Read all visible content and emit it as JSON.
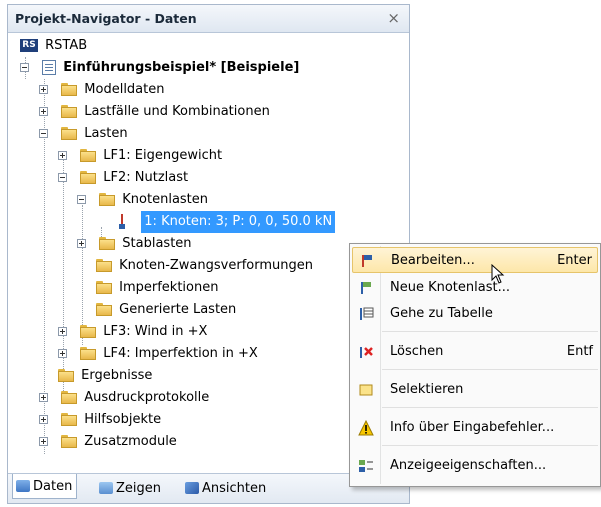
{
  "panel": {
    "title": "Projekt-Navigator - Daten",
    "close": "×"
  },
  "tree": {
    "root": "RSTAB",
    "project": "Einführungsbeispiel* [Beispiele]",
    "items": {
      "modelldaten": "Modelldaten",
      "lastfaelle": "Lastfälle und Kombinationen",
      "lasten": "Lasten",
      "lf1": "LF1: Eigengewicht",
      "lf2": "LF2: Nutzlast",
      "knotenlasten": "Knotenlasten",
      "knotenlast_item": "1: Knoten: 3; P: 0, 0, 50.0 kN",
      "stablasten": "Stablasten",
      "zwang": "Knoten-Zwangsverformungen",
      "imperf": "Imperfektionen",
      "generiert": "Generierte Lasten",
      "lf3": "LF3: Wind in +X",
      "lf4": "LF4: Imperfektion in +X",
      "ergebnisse": "Ergebnisse",
      "ausdruck": "Ausdruckprotokolle",
      "hilfs": "Hilfsobjekte",
      "zusatz": "Zusatzmodule"
    }
  },
  "bottom_tabs": {
    "daten": "Daten",
    "zeigen": "Zeigen",
    "ansichten": "Ansichten"
  },
  "context_menu": {
    "bearbeiten": "Bearbeiten...",
    "bearbeiten_key": "Enter",
    "neue": "Neue Knotenlast...",
    "gehe": "Gehe zu Tabelle",
    "loeschen": "Löschen",
    "loeschen_key": "Entf",
    "selektieren": "Selektieren",
    "info": "Info über Eingabefehler...",
    "anzeige": "Anzeigeeigenschaften..."
  },
  "colors": {
    "selection": "#3399ff",
    "folder": "#f2c94c",
    "menu_hover": "#fde7a9"
  }
}
